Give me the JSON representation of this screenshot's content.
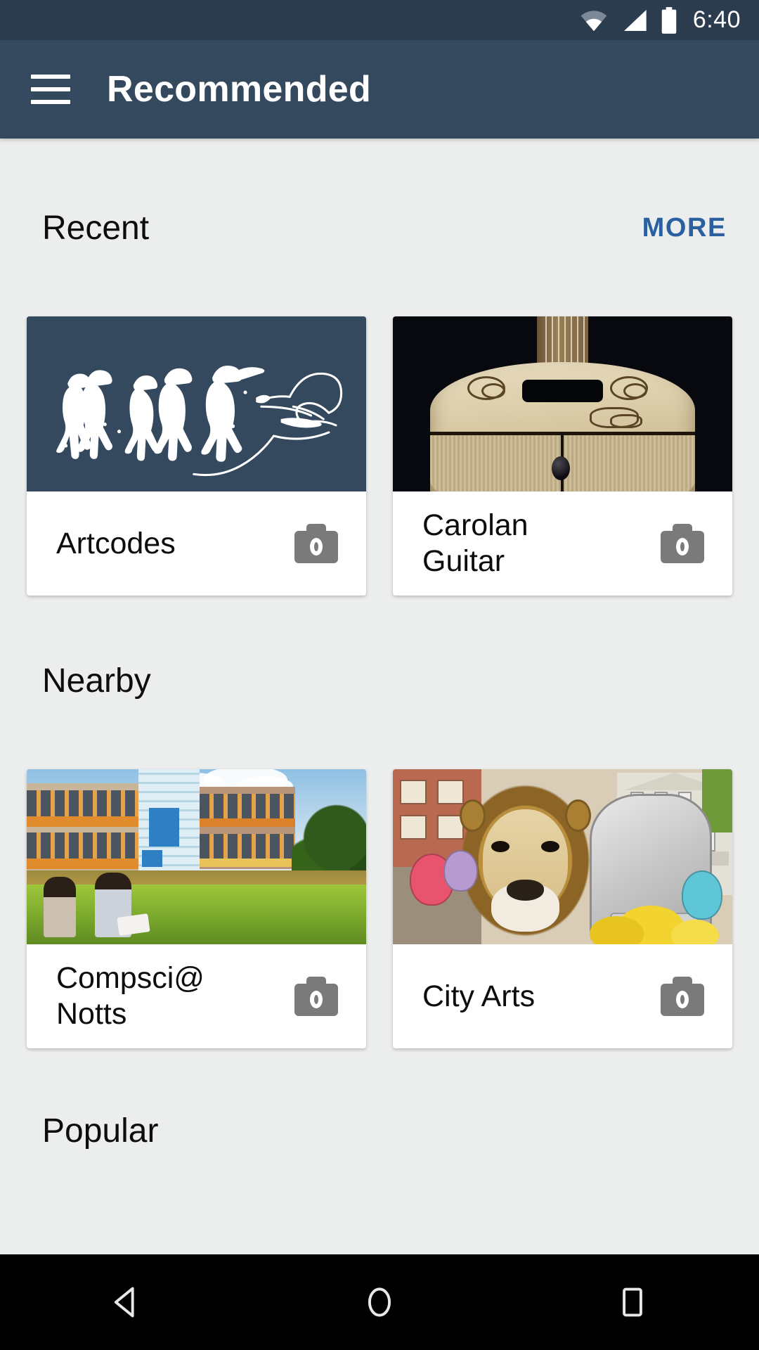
{
  "status_bar": {
    "time": "6:40",
    "icons": [
      "wifi-icon",
      "cellular-signal-icon",
      "battery-icon"
    ]
  },
  "app_bar": {
    "menu_icon": "hamburger-menu-icon",
    "title": "Recommended"
  },
  "colors": {
    "app_bar": "#34495e",
    "status_bar": "#2b3c4e",
    "background": "#eceded",
    "card": "#ffffff",
    "more_link": "#2a5fa0",
    "camera_icon": "#7a7a7a",
    "nav_bar": "#000000"
  },
  "sections": [
    {
      "title": "Recent",
      "more_label": "MORE",
      "has_more": true,
      "cards": [
        {
          "label": "Artcodes",
          "action_icon": "camera-icon",
          "artwork": "penguins-line-art"
        },
        {
          "label": "Carolan Guitar",
          "action_icon": "camera-icon",
          "artwork": "acoustic-guitar-photo"
        }
      ]
    },
    {
      "title": "Nearby",
      "more_label": "",
      "has_more": false,
      "cards": [
        {
          "label": "Compsci@ Notts",
          "action_icon": "camera-icon",
          "artwork": "campus-photo"
        },
        {
          "label": "City Arts",
          "action_icon": "camera-icon",
          "artwork": "lion-illustration"
        }
      ]
    }
  ],
  "popular_section": {
    "title": "Popular"
  },
  "nav_bar": {
    "buttons": [
      {
        "name": "back-button",
        "icon": "back-triangle-icon"
      },
      {
        "name": "home-button",
        "icon": "home-circle-icon"
      },
      {
        "name": "recents-button",
        "icon": "recents-square-icon"
      }
    ]
  }
}
